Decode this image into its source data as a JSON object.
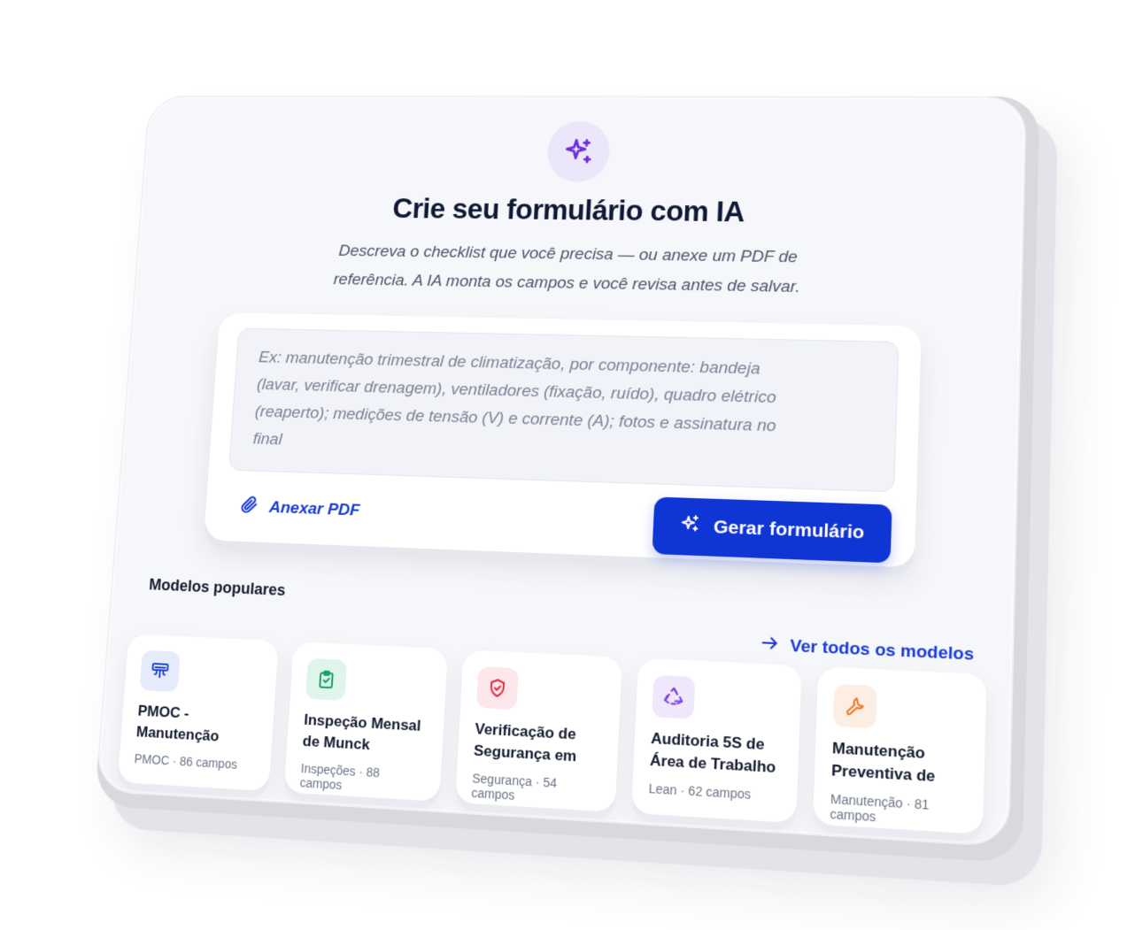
{
  "hero": {
    "icon": "sparkles-icon",
    "title": "Crie seu formulário com IA",
    "subtitle_line1": "Descreva o checklist que você precisa — ou anexe um PDF de",
    "subtitle_line2": "referência. A IA monta os campos e você revisa antes de salvar."
  },
  "composer": {
    "placeholder_line1": "Ex: manutenção trimestral de climatização, por componente: bandeja",
    "placeholder_line2": "(lavar, verificar drenagem), ventiladores (fixação, ruído), quadro elétrico",
    "placeholder_line3": "(reaperto); medições de tensão (V) e corrente (A); fotos e assinatura no",
    "placeholder_line4": "final",
    "attach_label": "Anexar PDF",
    "attach_icon": "paperclip-icon",
    "generate_label": "Gerar formulário",
    "generate_icon": "sparkles-icon"
  },
  "templates": {
    "section_title": "Modelos populares",
    "see_all_label": "Ver todos os modelos",
    "see_all_icon": "arrow-right-icon",
    "items": [
      {
        "title": "PMOC - Manutenção Semestral de Climat...",
        "category": "PMOC",
        "fields": "86 campos",
        "icon": "ac-unit-icon",
        "bg": "#e5ebfb",
        "fg": "#2345c9"
      },
      {
        "title": "Inspeção Mensal de Munck (Guindaste V...",
        "category": "Inspeções",
        "fields": "88 campos",
        "icon": "clipboard-check-icon",
        "bg": "#dff5ec",
        "fg": "#16a06a"
      },
      {
        "title": "Verificação de Segurança em Máq...",
        "category": "Segurança",
        "fields": "54 campos",
        "icon": "shield-check-icon",
        "bg": "#fde7ea",
        "fg": "#df2b46"
      },
      {
        "title": "Auditoria 5S de Área de Trabalho",
        "category": "Lean",
        "fields": "62 campos",
        "icon": "recycle-icon",
        "bg": "#efe7fc",
        "fg": "#7a3fe0"
      },
      {
        "title": "Manutenção Preventiva de Comp...",
        "category": "Manutenção",
        "fields": "81 campos",
        "icon": "wrench-icon",
        "bg": "#fdeee3",
        "fg": "#ec7a2c"
      }
    ]
  },
  "colors": {
    "accent": "#0f35d4",
    "link": "#1a3ad3",
    "hero_icon_bg": "#ece6fb",
    "hero_icon_fg": "#6b2fe0"
  }
}
